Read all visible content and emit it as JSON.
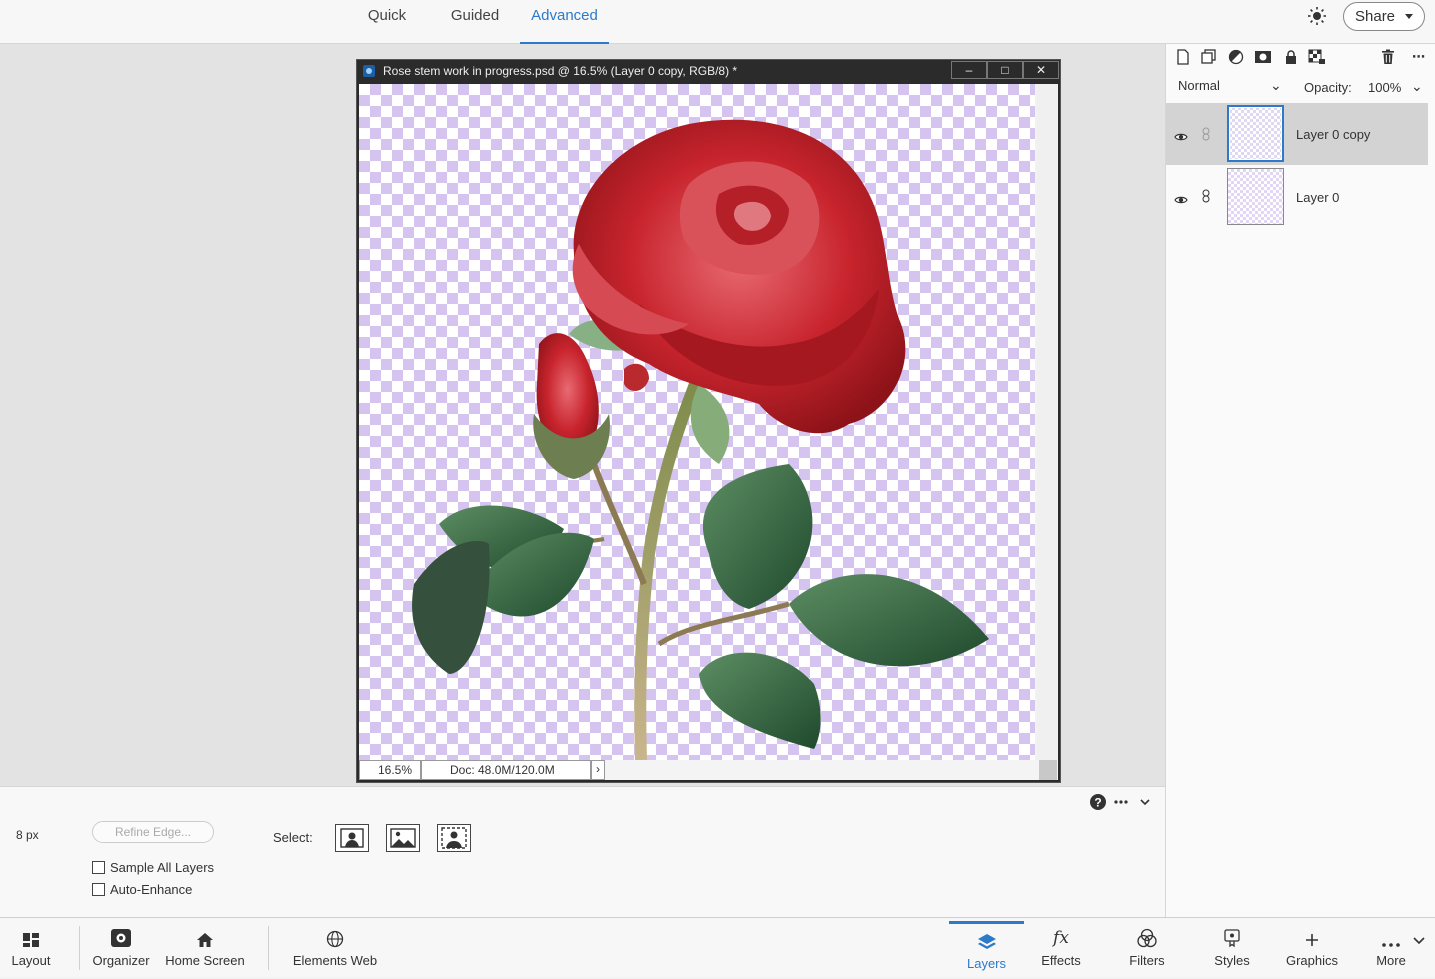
{
  "mode_tabs": [
    {
      "label": "Quick"
    },
    {
      "label": "Guided"
    },
    {
      "label": "Advanced",
      "active": true
    }
  ],
  "header": {
    "share_label": "Share",
    "theme_icon": "sun-icon"
  },
  "document": {
    "title": "Rose stem work in progress.psd @ 16.5% (Layer 0 copy, RGB/8) *",
    "zoom": "16.5%",
    "doc_info": "Doc: 48.0M/120.0M",
    "window_buttons": [
      "minimize-icon",
      "maximize-icon",
      "close-icon"
    ]
  },
  "layers_panel": {
    "blend_mode": "Normal",
    "opacity_label": "Opacity:",
    "opacity_value": "100%",
    "toolbar_icons": [
      "new-layer-icon",
      "new-group-icon",
      "adjustment-layer-icon",
      "layer-mask-icon",
      "lock-icon",
      "lock-transparency-icon",
      "trash-icon",
      "more-icon"
    ],
    "layers": [
      {
        "name": "Layer 0 copy",
        "selected": true,
        "visible": true
      },
      {
        "name": "Layer 0",
        "selected": false,
        "visible": true
      }
    ]
  },
  "tool_options": {
    "brush_size": "8 px",
    "refine_edge_label": "Refine Edge...",
    "sample_all_layers_label": "Sample All Layers",
    "auto_enhance_label": "Auto-Enhance",
    "select_label": "Select:",
    "select_buttons": [
      "select-subject-icon",
      "select-sky-icon",
      "select-background-icon"
    ]
  },
  "bottom_bar": {
    "left": [
      {
        "label": "Layout",
        "icon": "layout-icon"
      },
      {
        "label": "Organizer",
        "icon": "organizer-icon"
      },
      {
        "label": "Home Screen",
        "icon": "home-icon"
      },
      {
        "label": "Elements Web",
        "icon": "globe-icon"
      }
    ],
    "right": [
      {
        "label": "Layers",
        "icon": "layers-icon",
        "active": true
      },
      {
        "label": "Effects",
        "icon": "fx-icon"
      },
      {
        "label": "Filters",
        "icon": "filters-icon"
      },
      {
        "label": "Styles",
        "icon": "styles-icon"
      },
      {
        "label": "Graphics",
        "icon": "plus-icon"
      },
      {
        "label": "More",
        "icon": "more-icon"
      }
    ],
    "fx_glyph": "fx"
  },
  "colors": {
    "accent": "#2c7ac9",
    "checker_purple": "#d5c4f0"
  }
}
